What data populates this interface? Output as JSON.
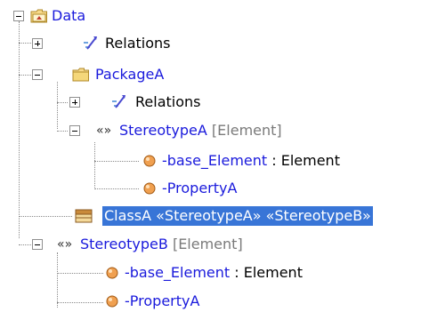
{
  "tree": {
    "root": {
      "label": "Data",
      "icon": "package-icon-open"
    },
    "relations_1": {
      "label": "Relations",
      "icon": "relations-icon"
    },
    "package_a": {
      "label": "PackageA",
      "icon": "package-folder-icon"
    },
    "relations_2": {
      "label": "Relations",
      "icon": "relations-icon"
    },
    "stereotype_a": {
      "glyph": "«»",
      "name": "StereotypeA",
      "meta": "[Element]",
      "children": [
        {
          "name": "-base_Element",
          "type": " : Element",
          "icon": "property-icon"
        },
        {
          "name": "-PropertyA",
          "type": "",
          "icon": "property-icon"
        }
      ]
    },
    "class_a": {
      "label": "ClassA «StereotypeA» «StereotypeB»",
      "icon": "class-icon",
      "selected": true
    },
    "stereotype_b": {
      "glyph": "«»",
      "name": "StereotypeB",
      "meta": "[Element]",
      "children": [
        {
          "name": "-base_Element",
          "type": " : Element",
          "icon": "property-icon"
        },
        {
          "name": "-PropertyA",
          "type": "",
          "icon": "property-icon"
        }
      ]
    }
  },
  "colors": {
    "link_blue": "#1a1adc",
    "meta_gray": "#7a7a7a",
    "selection": "#3875d7",
    "property_orange": "#f0a050"
  }
}
